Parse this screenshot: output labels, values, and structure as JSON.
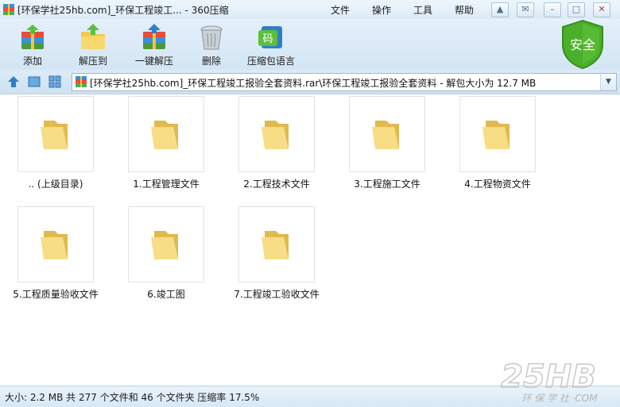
{
  "window": {
    "title": "[环保学社25hb.com]_环保工程竣工... - 360压缩"
  },
  "menu": [
    "文件",
    "操作",
    "工具",
    "帮助"
  ],
  "toolbar": {
    "add_label": "添加",
    "extract_to_label": "解压到",
    "one_click_extract_label": "一键解压",
    "delete_label": "删除",
    "language_label": "压缩包语言",
    "language_icon_text": "码"
  },
  "security_badge": {
    "label": "安全",
    "color": "#4caf2a"
  },
  "address": {
    "path": "[环保学社25hb.com]_环保工程竣工报验全套资料.rar\\环保工程竣工报验全套资料 - 解包大小为 12.7 MB"
  },
  "files": [
    {
      "name": ".. (上级目录)"
    },
    {
      "name": "1.工程管理文件"
    },
    {
      "name": "2.工程技术文件"
    },
    {
      "name": "3.工程施工文件"
    },
    {
      "name": "4.工程物资文件"
    },
    {
      "name": "5.工程质量验收文件"
    },
    {
      "name": "6.竣工图"
    },
    {
      "name": "7.工程竣工验收文件"
    }
  ],
  "status": {
    "text": "大小: 2.2 MB 共 277 个文件和 46 个文件夹 压缩率 17.5%"
  },
  "watermark": {
    "brand": "25HB",
    "subtitle": "环 保 学 社 ·COM"
  },
  "colors": {
    "folder": "#f3d77d",
    "folder_dark": "#e2b94d",
    "accent_blue": "#2f7fc6"
  }
}
